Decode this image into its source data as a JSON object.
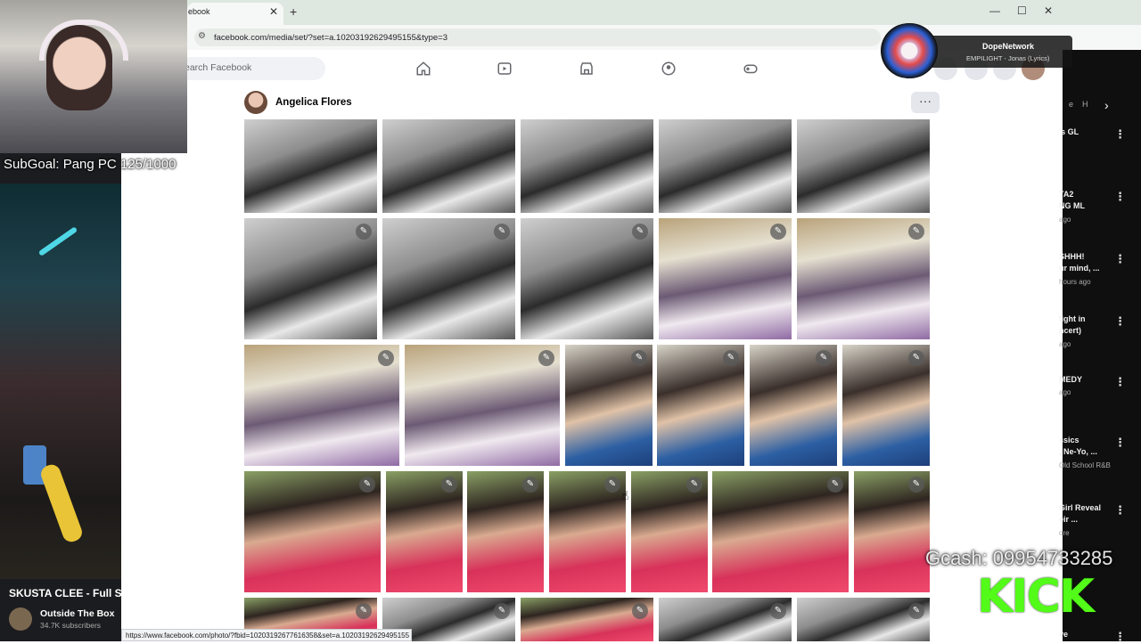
{
  "browser": {
    "tab_title": "ebook",
    "url": "facebook.com/media/set/?set=a.10203192629495155&type=3",
    "status_url": "https://www.facebook.com/photo/?fbid=10203192677616358&set=a.10203192629495155"
  },
  "facebook": {
    "search_placeholder": "earch Facebook",
    "album_owner": "Angelica Flores"
  },
  "grid": {
    "rows": [
      {
        "photos": [
          {
            "style": "group",
            "editable": false
          },
          {
            "style": "group",
            "editable": false
          },
          {
            "style": "group",
            "editable": false
          },
          {
            "style": "group",
            "editable": false
          },
          {
            "style": "group",
            "editable": false
          }
        ]
      },
      {
        "photos": [
          {
            "style": "group",
            "editable": true
          },
          {
            "style": "group",
            "editable": true
          },
          {
            "style": "group",
            "editable": true
          },
          {
            "style": "class",
            "editable": true
          },
          {
            "style": "class",
            "editable": true
          }
        ]
      },
      {
        "photos": [
          {
            "style": "class",
            "editable": true
          },
          {
            "style": "class",
            "editable": true
          },
          {
            "style": "blue",
            "editable": true
          },
          {
            "style": "blue",
            "editable": true
          },
          {
            "style": "blue",
            "editable": true
          },
          {
            "style": "blue",
            "editable": true
          }
        ]
      },
      {
        "photos": [
          {
            "style": "pink",
            "editable": true
          },
          {
            "style": "pink",
            "editable": true
          },
          {
            "style": "pink",
            "editable": true
          },
          {
            "style": "pink",
            "editable": true
          },
          {
            "style": "pink",
            "editable": true
          },
          {
            "style": "pink",
            "editable": true
          },
          {
            "style": "pink",
            "editable": true
          }
        ]
      },
      {
        "photos": [
          {
            "style": "pink",
            "editable": true
          },
          {
            "style": "group",
            "editable": true
          },
          {
            "style": "pink",
            "editable": true
          },
          {
            "style": "group",
            "editable": true
          },
          {
            "style": "group",
            "editable": true
          },
          {
            "style": "stage",
            "editable": true
          }
        ]
      }
    ]
  },
  "stream_overlay": {
    "subgoal": "SubGoal: Pang PC 125/1000",
    "video_title": "SKUSTA CLEE - Full S",
    "channel_name": "Outside The Box",
    "channel_subs": "34.7K subscribers",
    "now_playing_title": "DopeNetwork",
    "now_playing_sub": "EMPILIGHT - Jonas (Lyrics)",
    "cashtag": "Gcash: 09954733285",
    "kick_logo": "KICK"
  },
  "youtube_sidebar": {
    "items": [
      {
        "title": "'s GL",
        "meta": ""
      },
      {
        "title": "TA2\nNG ML",
        "meta": "ago"
      },
      {
        "title": "SHHH!\nur mind, ...",
        "meta": "hours ago"
      },
      {
        "title": "light in\nncert)",
        "meta": "ago"
      },
      {
        "title": "MEDY",
        "meta": "ago"
      },
      {
        "title": "ssics \n, Ne-Yo, ...",
        "meta": "Old School R&B"
      },
      {
        "title": "Girl Reveal\neir ...",
        "meta": "ore"
      },
      {
        "title": "ve",
        "meta": ""
      }
    ]
  }
}
